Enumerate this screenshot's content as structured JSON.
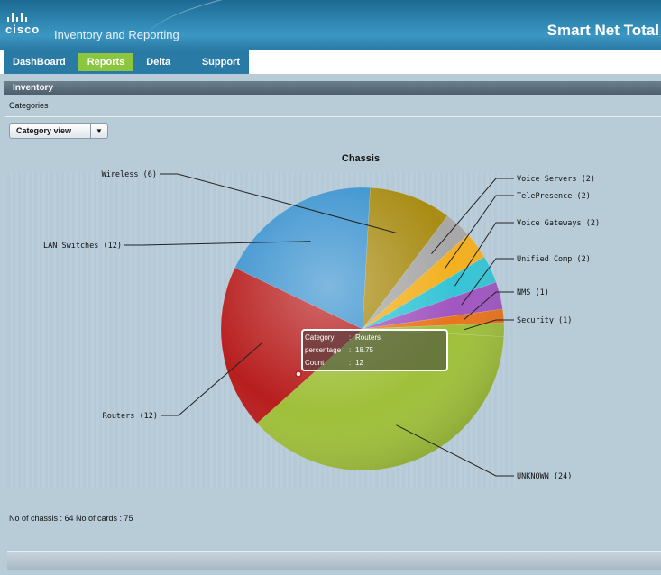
{
  "header": {
    "logo_text": "cisco",
    "app_title": "Inventory and Reporting",
    "brand": "Smart Net Total"
  },
  "nav": {
    "items": [
      {
        "label": "DashBoard",
        "active": false
      },
      {
        "label": "Reports",
        "active": true
      },
      {
        "label": "Delta Reports",
        "active": false
      },
      {
        "label": "Support",
        "active": false
      }
    ]
  },
  "section": {
    "title": "Inventory"
  },
  "breadcrumb": {
    "label": "Categories"
  },
  "view_select": {
    "selected": "Category view",
    "arrow_icon": "chevron-down-icon"
  },
  "tooltip": {
    "rows": [
      {
        "key": "Category",
        "value": "Routers"
      },
      {
        "key": "percentage",
        "value": "18.75"
      },
      {
        "key": "Count",
        "value": "12"
      }
    ]
  },
  "footer": {
    "summary": "No of chassis : 64   No of cards : 75"
  },
  "colors": {
    "UNKNOWN": "#9fc03a",
    "Routers": "#b81e1e",
    "LAN Switches": "#3a92cf",
    "Wireless": "#a88c14",
    "Voice Servers": "#a7a7a7",
    "TelePresence": "#f3b01e",
    "Voice Gateways": "#35c4d6",
    "Unified Comp": "#a056c0",
    "NMS": "#e8741c",
    "Security": "#9fc03a"
  },
  "chart_data": {
    "type": "pie",
    "title": "Chassis",
    "start_angle_deg": 0,
    "direction": "clockwise",
    "slices": [
      {
        "label": "UNKNOWN",
        "value": 24,
        "display": "UNKNOWN (24)",
        "label_side": "right"
      },
      {
        "label": "Routers",
        "value": 12,
        "display": "Routers (12)",
        "label_side": "left"
      },
      {
        "label": "LAN Switches",
        "value": 12,
        "display": "LAN Switches (12)",
        "label_side": "left"
      },
      {
        "label": "Wireless",
        "value": 6,
        "display": "Wireless (6)",
        "label_side": "left"
      },
      {
        "label": "Voice Servers",
        "value": 2,
        "display": "Voice Servers (2)",
        "label_side": "right"
      },
      {
        "label": "TelePresence",
        "value": 2,
        "display": "TelePresence (2)",
        "label_side": "right"
      },
      {
        "label": "Voice Gateways",
        "value": 2,
        "display": "Voice Gateways (2)",
        "label_side": "right"
      },
      {
        "label": "Unified Comp",
        "value": 2,
        "display": "Unified Comp (2)",
        "label_side": "right"
      },
      {
        "label": "NMS",
        "value": 1,
        "display": "NMS (1)",
        "label_side": "right"
      },
      {
        "label": "Security",
        "value": 1,
        "display": "Security (1)",
        "label_side": "right"
      }
    ]
  }
}
